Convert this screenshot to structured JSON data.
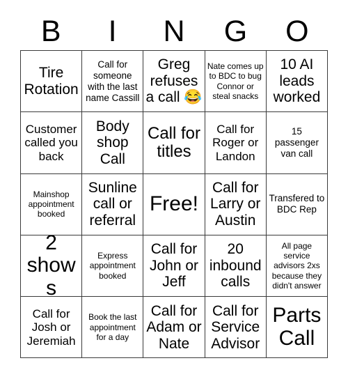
{
  "card": {
    "header_letters": [
      "B",
      "I",
      "N",
      "G",
      "O"
    ],
    "columns": 5,
    "rows": 5,
    "border_color": "#3a3a3a",
    "background_color": "#ffffff",
    "text_color": "#000000",
    "cells": [
      [
        {
          "text": "Tire Rotation",
          "size": "lg"
        },
        {
          "text": "Call for someone with the last name Cassill",
          "size": "sm"
        },
        {
          "text": "Greg refuses a call 😂",
          "size": "lg"
        },
        {
          "text": "Nate comes up to BDC to bug Connor or steal snacks",
          "size": "xs"
        },
        {
          "text": "10 AI leads worked",
          "size": "lg"
        }
      ],
      [
        {
          "text": "Customer called you back",
          "size": "md"
        },
        {
          "text": "Body shop Call",
          "size": "lg"
        },
        {
          "text": "Call for titles",
          "size": "xl"
        },
        {
          "text": "Call for Roger or Landon",
          "size": "md"
        },
        {
          "text": "15 passenger van call",
          "size": "sm"
        }
      ],
      [
        {
          "text": "Mainshop appointment booked",
          "size": "xs"
        },
        {
          "text": "Sunline call or referral",
          "size": "lg"
        },
        {
          "text": "Free!",
          "size": "xxl"
        },
        {
          "text": "Call for Larry or Austin",
          "size": "lg"
        },
        {
          "text": "Transfered to BDC Rep",
          "size": "sm"
        }
      ],
      [
        {
          "text": "2 shows",
          "size": "xxl"
        },
        {
          "text": "Express appointment booked",
          "size": "xs"
        },
        {
          "text": "Call for John or Jeff",
          "size": "lg"
        },
        {
          "text": "20 inbound calls",
          "size": "lg"
        },
        {
          "text": "All page service advisors 2xs because they didn't answer",
          "size": "xs"
        }
      ],
      [
        {
          "text": "Call for Josh or Jeremiah",
          "size": "md"
        },
        {
          "text": "Book the last appointment for a day",
          "size": "xs"
        },
        {
          "text": "Call for Adam or Nate",
          "size": "lg"
        },
        {
          "text": "Call for Service Advisor",
          "size": "lg"
        },
        {
          "text": "Parts Call",
          "size": "xxl"
        }
      ]
    ]
  }
}
